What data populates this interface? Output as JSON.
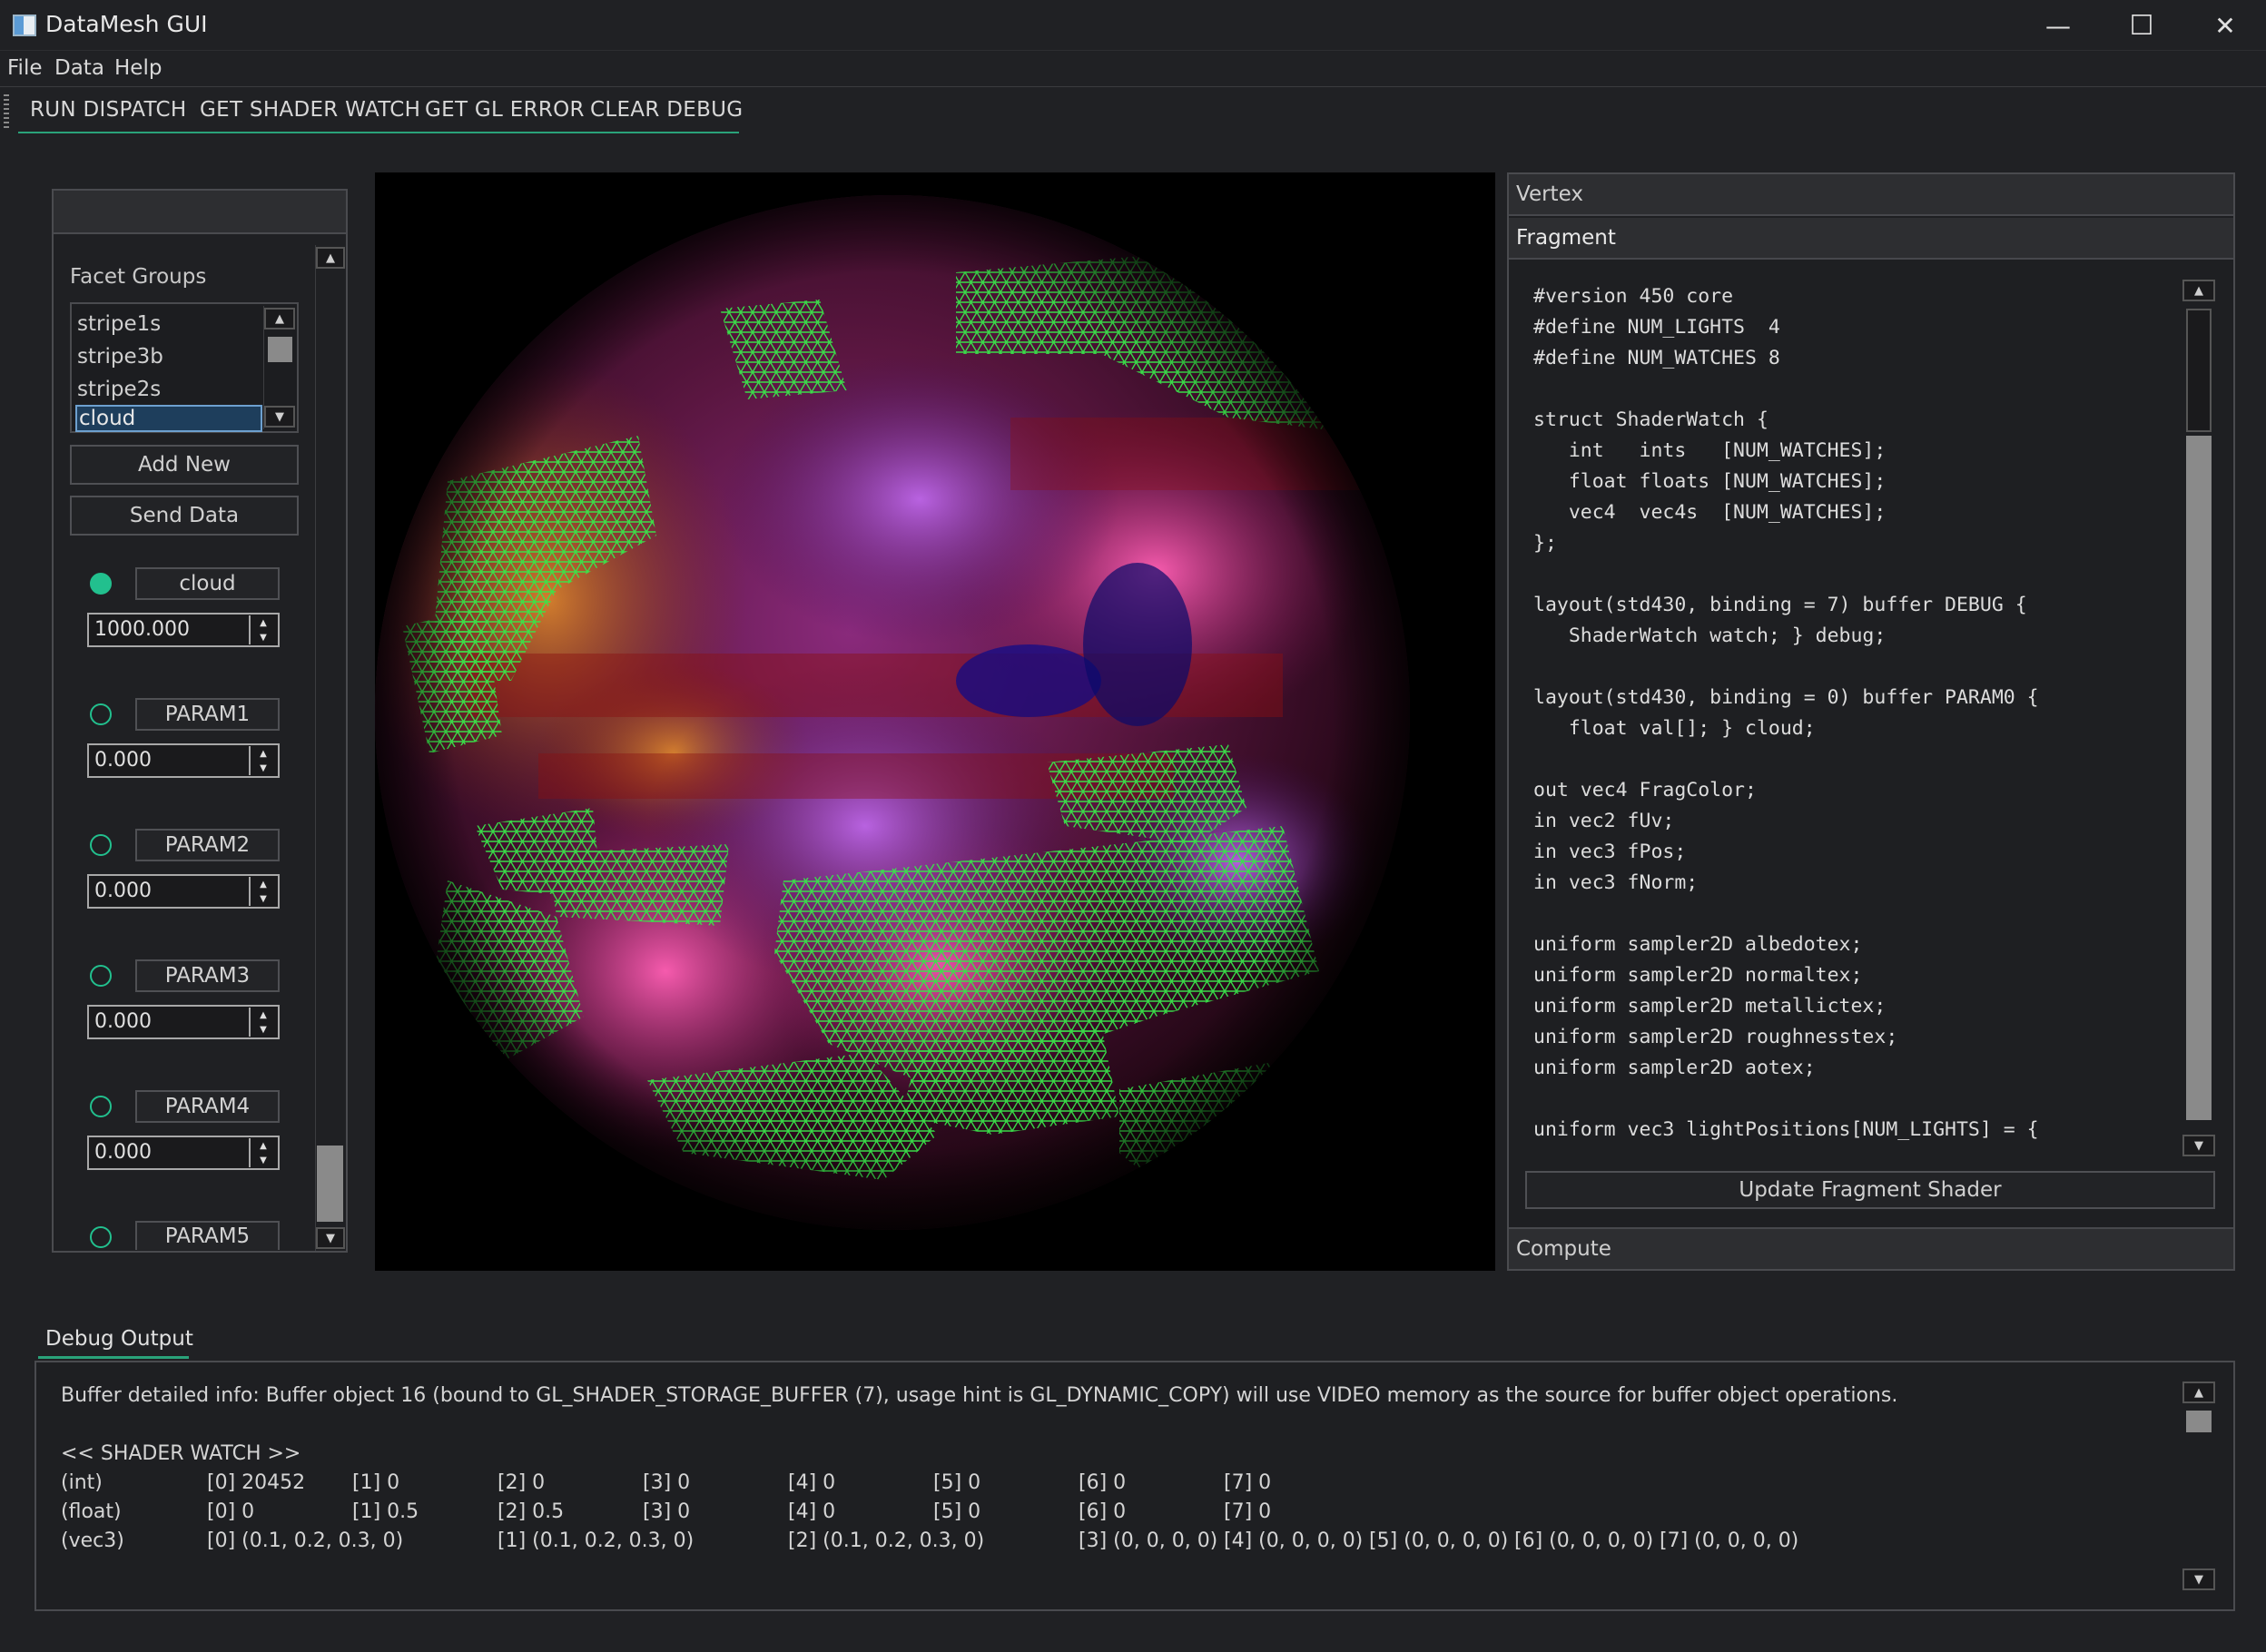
{
  "window": {
    "title": "DataMesh GUI",
    "controls": {
      "minimize": "—",
      "maximize": "☐",
      "close": "✕"
    }
  },
  "menu": {
    "items": [
      "File",
      "Data",
      "Help"
    ]
  },
  "toolbar": {
    "buttons": [
      "RUN DISPATCH",
      "GET SHADER WATCH",
      "GET GL ERROR",
      "CLEAR DEBUG"
    ]
  },
  "left_panel": {
    "facet_groups_label": "Facet Groups",
    "facet_groups": [
      "stripe1s",
      "stripe3b",
      "stripe2s",
      "cloud"
    ],
    "selected_facet": "cloud",
    "add_new_label": "Add New",
    "send_data_label": "Send Data",
    "params": [
      {
        "name": "cloud",
        "value": "1000.000",
        "active": true
      },
      {
        "name": "PARAM1",
        "value": "0.000",
        "active": false
      },
      {
        "name": "PARAM2",
        "value": "0.000",
        "active": false
      },
      {
        "name": "PARAM3",
        "value": "0.000",
        "active": false
      },
      {
        "name": "PARAM4",
        "value": "0.000",
        "active": false
      },
      {
        "name": "PARAM5",
        "value": "",
        "active": false
      }
    ]
  },
  "shader_panel": {
    "sections": [
      "Vertex",
      "Fragment",
      "Compute"
    ],
    "expanded": "Fragment",
    "code_lines": [
      "#version 450 core",
      "#define NUM_LIGHTS  4",
      "#define NUM_WATCHES 8",
      "",
      "struct ShaderWatch {",
      "   int   ints   [NUM_WATCHES];",
      "   float floats [NUM_WATCHES];",
      "   vec4  vec4s  [NUM_WATCHES];",
      "};",
      "",
      "layout(std430, binding = 7) buffer DEBUG {",
      "   ShaderWatch watch; } debug;",
      "",
      "layout(std430, binding = 0) buffer PARAM0 {",
      "   float val[]; } cloud;",
      "",
      "out vec4 FragColor;",
      "in vec2 fUv;",
      "in vec3 fPos;",
      "in vec3 fNorm;",
      "",
      "uniform sampler2D albedotex;",
      "uniform sampler2D normaltex;",
      "uniform sampler2D metallictex;",
      "uniform sampler2D roughnesstex;",
      "uniform sampler2D aotex;",
      "",
      "uniform vec3 lightPositions[NUM_LIGHTS] = {"
    ],
    "update_button": "Update Fragment Shader"
  },
  "debug": {
    "tab_label": "Debug Output",
    "info": "Buffer detailed info: Buffer object 16 (bound to GL_SHADER_STORAGE_BUFFER (7), usage hint is GL_DYNAMIC_COPY) will use VIDEO memory as the source for buffer object operations.",
    "watch_header": "<< SHADER WATCH >>",
    "int_label": "(int)",
    "ints": [
      "[0] 20452",
      "[1] 0",
      "[2] 0",
      "[3] 0",
      "[4] 0",
      "[5] 0",
      "[6] 0",
      "[7] 0"
    ],
    "float_label": "(float)",
    "floats": [
      "[0] 0",
      "[1] 0.5",
      "[2] 0.5",
      "[3] 0",
      "[4] 0",
      "[5] 0",
      "[6] 0",
      "[7] 0"
    ],
    "vec3_label": "(vec3)",
    "vec3s": [
      "[0] (0.1, 0.2, 0.3, 0)",
      "[1] (0.1, 0.2, 0.3, 0)",
      "[2] (0.1, 0.2, 0.3, 0)",
      "[3] (0, 0, 0, 0)",
      "[4] (0, 0, 0, 0)",
      "[5] (0, 0, 0, 0)",
      "[6] (0, 0, 0, 0)",
      "[7] (0, 0, 0, 0)"
    ]
  },
  "colors": {
    "accent": "#2aa37a",
    "mesh_wire": "#39e64a",
    "selection": "#1e3e5c"
  }
}
